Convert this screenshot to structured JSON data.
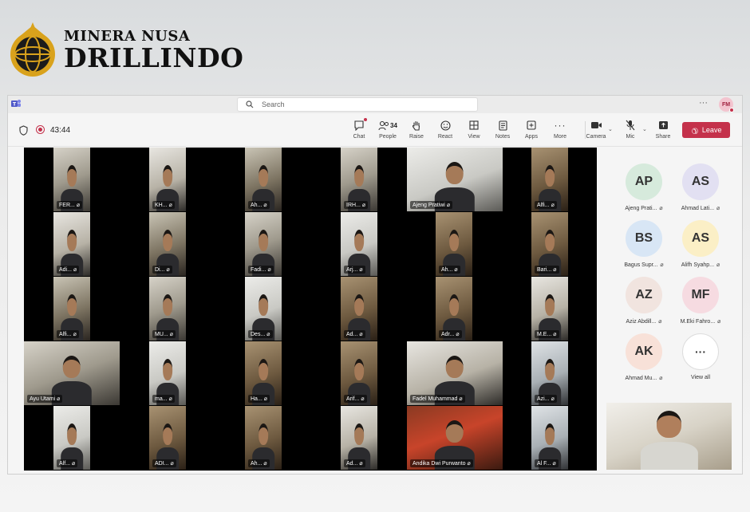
{
  "logo": {
    "line1": "MINERA NUSA",
    "line2": "DRILLINDO",
    "emblem": "globe-emblem-icon"
  },
  "titlebar": {
    "search_placeholder": "Search",
    "more": "···",
    "avatar": "FM"
  },
  "meeting": {
    "timer": "43:44"
  },
  "toolbar": {
    "chat": "Chat",
    "people": "People",
    "people_count": "34",
    "raise": "Raise",
    "react": "React",
    "view": "View",
    "notes": "Notes",
    "apps": "Apps",
    "more": "More",
    "camera": "Camera",
    "mic": "Mic",
    "share": "Share",
    "leave": "Leave"
  },
  "colors": {
    "leave": "#c4314b",
    "recording": "#c4314b",
    "teams": "#5059c9"
  },
  "tiles": [
    {
      "name": "FER..."
    },
    {
      "name": "KH..."
    },
    {
      "name": "Ah..."
    },
    {
      "name": "IRH..."
    },
    {
      "name": "Ajeng Pratiwi"
    },
    {
      "name": "Alfi..."
    },
    {
      "name": "Adi..."
    },
    {
      "name": "Di..."
    },
    {
      "name": "Fadi..."
    },
    {
      "name": "Arj..."
    },
    {
      "name": "Ah..."
    },
    {
      "name": "Bari..."
    },
    {
      "name": "Alfi..."
    },
    {
      "name": "MU..."
    },
    {
      "name": "Des..."
    },
    {
      "name": "Ad..."
    },
    {
      "name": "Adr..."
    },
    {
      "name": "M.E..."
    },
    {
      "name": "Ayu Utami"
    },
    {
      "name": "ma..."
    },
    {
      "name": "Ha..."
    },
    {
      "name": "Arif..."
    },
    {
      "name": "Fadel Muhammad"
    },
    {
      "name": "Azi..."
    },
    {
      "name": "Alf..."
    },
    {
      "name": "ADI..."
    },
    {
      "name": "Ah..."
    },
    {
      "name": "Ad..."
    },
    {
      "name": "Andika Dwi Purwanto"
    },
    {
      "name": "Al F..."
    }
  ],
  "participants": [
    {
      "initials": "AP",
      "name": "Ajeng Prati...",
      "color": "#d6eadc"
    },
    {
      "initials": "AS",
      "name": "Ahmad Lati...",
      "color": "#e2e0f2"
    },
    {
      "initials": "BS",
      "name": "Bagus Supr...",
      "color": "#d8e6f5"
    },
    {
      "initials": "AS",
      "name": "Alifh Syahp...",
      "color": "#fbefc6"
    },
    {
      "initials": "AZ",
      "name": "Aziz Abdill...",
      "color": "#f1e4df"
    },
    {
      "initials": "MF",
      "name": "M.Eki Fahro...",
      "color": "#f6dbe1"
    },
    {
      "initials": "AK",
      "name": "Ahmad Mu...",
      "color": "#f8e1d8"
    },
    {
      "initials": "···",
      "name": "View all",
      "color": "#ffffff"
    }
  ]
}
